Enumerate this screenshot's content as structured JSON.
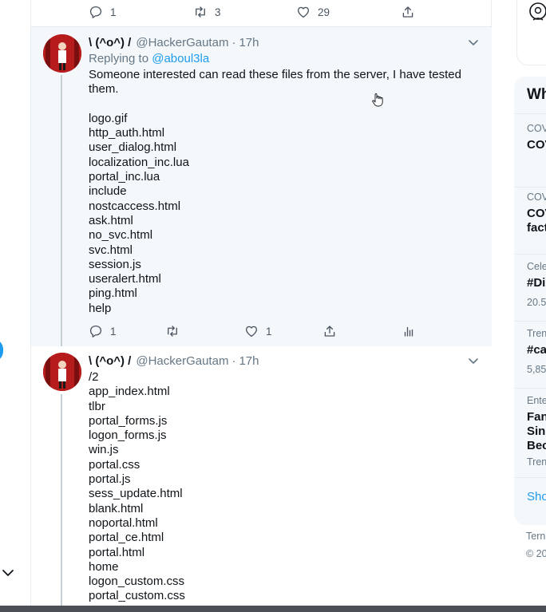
{
  "previous_tweet_actions": {
    "reply_count": "1",
    "retweet_count": "3",
    "like_count": "29"
  },
  "tweets": [
    {
      "display_name": "\\ (^o^) /",
      "handle": "@HackerGautam",
      "separator": "·",
      "time": "17h",
      "replying_prefix": "Replying to",
      "replying_to": "@aboul3la",
      "text": "Someone interested can read these files from the server, I have tested them.\n\nlogo.gif\nhttp_auth.html\nuser_dialog.html\nlocalization_inc.lua\nportal_inc.lua\ninclude\nnostcaccess.html\nask.html\nno_svc.html\nsvc.html\nsession.js\nuseralert.html\nping.html\nhelp",
      "reply_count": "1",
      "like_count": "1"
    },
    {
      "display_name": "\\ (^o^) /",
      "handle": "@HackerGautam",
      "separator": "·",
      "time": "17h",
      "text": "/2\napp_index.html\ntlbr\nportal_forms.js\nlogon_forms.js\nwin.js\nportal.css\nportal.js\nsess_update.html\nblank.html\nnoportal.html\nportal_ce.html\nportal.html\nhome\nlogon_custom.css\nportal_custom.css"
    }
  ],
  "sidebar": {
    "trends_title": "Wh",
    "trends": [
      {
        "category": "COV",
        "name": "COV"
      },
      {
        "category": "COV",
        "name": "COV\nfact"
      },
      {
        "category": "Cele",
        "name": "#Di",
        "count": "20.5"
      },
      {
        "category": "Tren",
        "name": "#ca",
        "count": "5,85"
      },
      {
        "category": "Ente",
        "name": "Fan\nSing\nBec",
        "count": "Tren"
      }
    ],
    "show_more": "Sho",
    "footer_terms": "Tern",
    "footer_copyright": "© 20"
  },
  "colors": {
    "accent": "#1d9bf0",
    "secondary_text": "#657786",
    "highlight_background": "#f5f8fa",
    "border": "#e6ecf0"
  },
  "icons": [
    "reply-icon",
    "retweet-icon",
    "like-icon",
    "share-icon",
    "analytics-icon",
    "caret-down-icon",
    "chevron-down-icon",
    "hand-cursor-icon"
  ]
}
